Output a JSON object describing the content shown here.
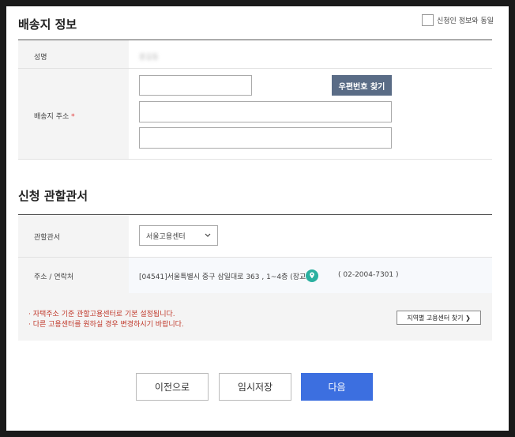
{
  "shipping": {
    "title": "배송지 정보",
    "same_as_applicant": "신청인 정보와 동일",
    "name_label": "성명",
    "name_value": "홍길동",
    "address_label": "배송지 주소",
    "required_mark": "*",
    "zip_button": "우편번호 찾기",
    "zip_value": "",
    "address1_value": "",
    "address2_value": ""
  },
  "jurisdiction": {
    "title": "신청 관할관서",
    "office_label": "관할관서",
    "office_selected": "서울고용센터",
    "contact_label": "주소 / 연락처",
    "address_text": "[04541]서울특별시 중구 삼일대로 363 , 1~4층 (장교동)",
    "phone_text": "( 02-2004-7301 )",
    "notes": [
      "· 자택주소 기준 관할고용센터로 기본 설정됩니다.",
      "· 다른 고용센터를 원하실 경우 변경하시기 바랍니다."
    ],
    "region_button": "지역별 고용센터 찾기 ❯"
  },
  "actions": {
    "prev": "이전으로",
    "temp_save": "임시저장",
    "next": "다음"
  },
  "colors": {
    "primary": "#3c6fe0",
    "zip_button": "#5a6c86",
    "required": "#e23a3a",
    "note": "#c0392b",
    "pin": "#2bb0a0"
  }
}
